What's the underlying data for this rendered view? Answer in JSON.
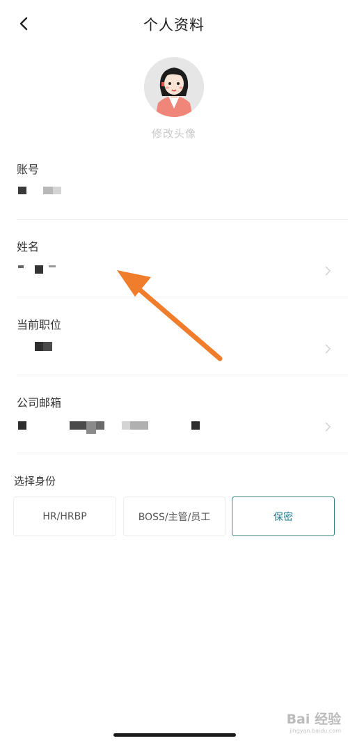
{
  "header": {
    "title": "个人资料"
  },
  "avatar": {
    "change_label": "修改头像"
  },
  "fields": [
    {
      "label": "账号"
    },
    {
      "label": "姓名"
    },
    {
      "label": "当前职位"
    },
    {
      "label": "公司邮箱"
    }
  ],
  "identity": {
    "label": "选择身份",
    "options": [
      "HR/HRBP",
      "BOSS/主管/员工",
      "保密"
    ],
    "selected": "保密"
  },
  "watermark": {
    "brand": "Bai 经验",
    "url": "jingyan.baidu.com"
  },
  "colors": {
    "accent": "#1e7a8e",
    "arrow": "#f07d2c",
    "divider": "#eeeeee"
  },
  "icons": [
    "back-arrow-icon",
    "chevron-right-icon",
    "avatar-illustration"
  ]
}
